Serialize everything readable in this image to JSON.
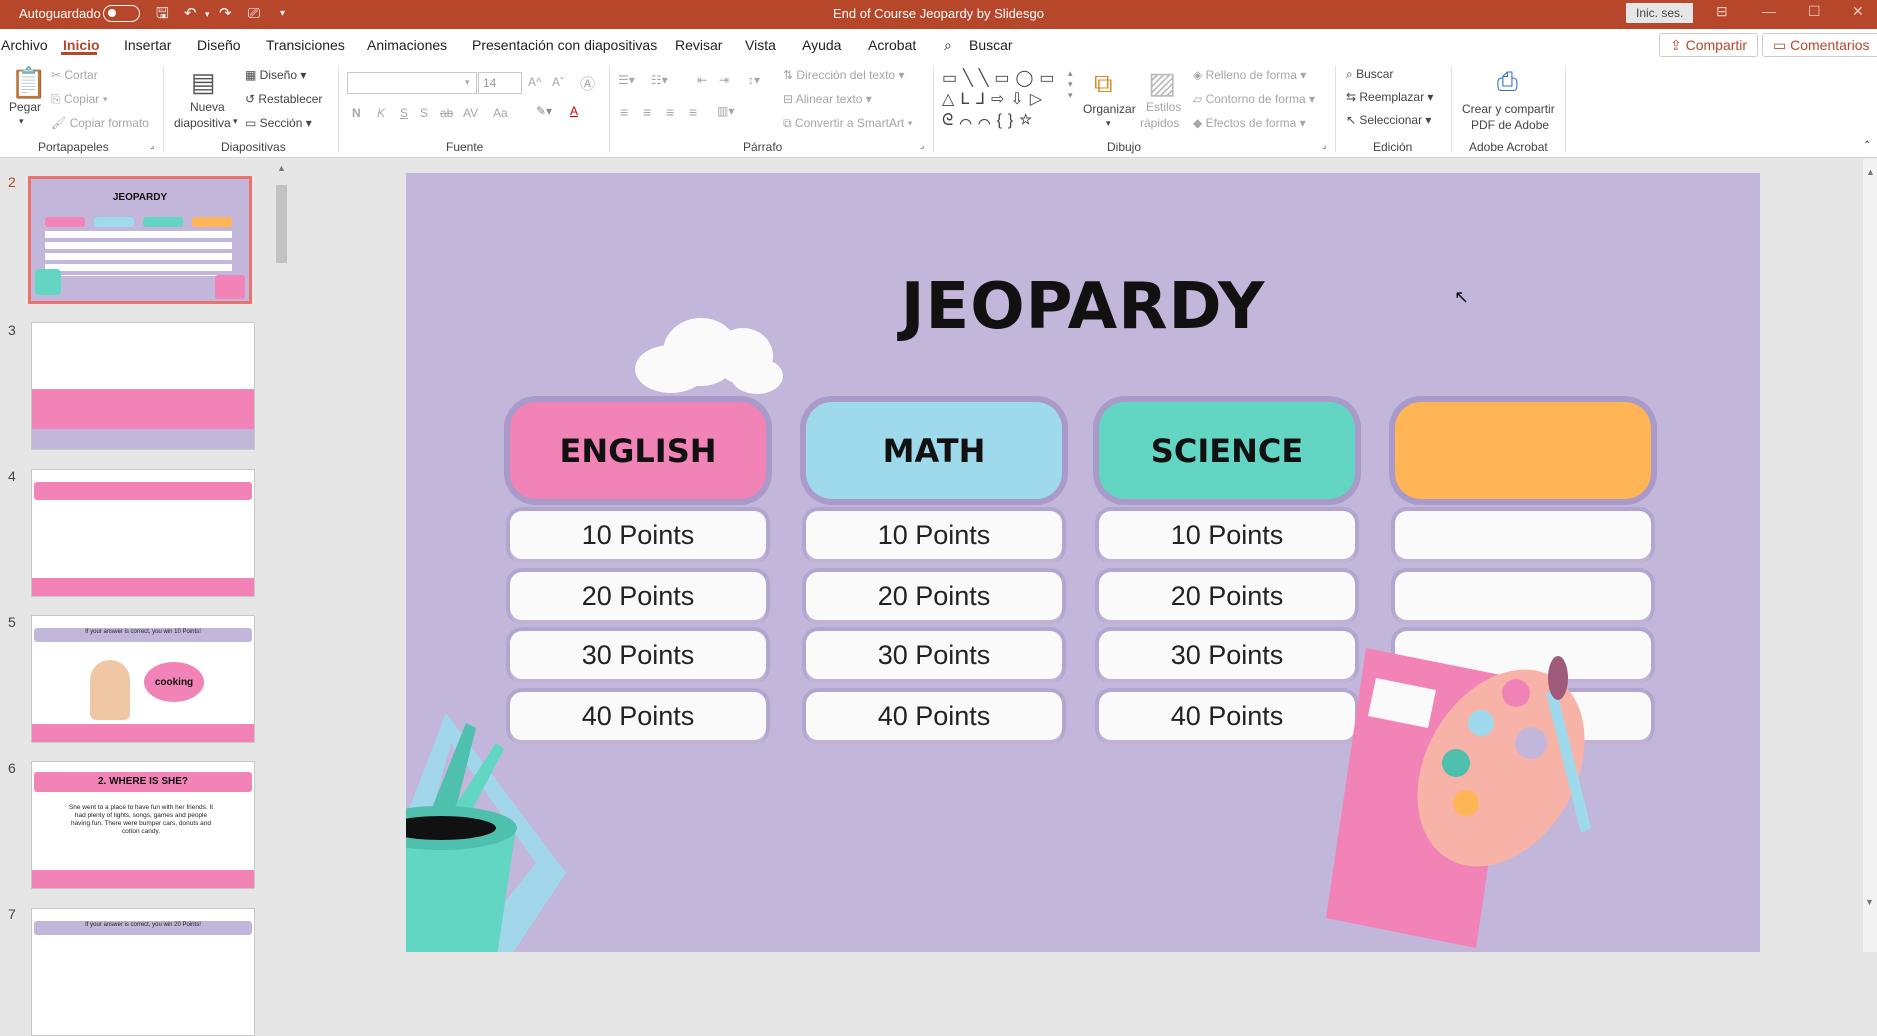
{
  "titlebar": {
    "autosave": "Autoguardado",
    "doc_title": "End of Course Jeopardy by Slidesgo",
    "signin": "Inic. ses."
  },
  "menu": {
    "tabs": [
      "Archivo",
      "Inicio",
      "Insertar",
      "Diseño",
      "Transiciones",
      "Animaciones",
      "Presentación con diapositivas",
      "Revisar",
      "Vista",
      "Ayuda",
      "Acrobat"
    ],
    "active_tab": "Inicio",
    "search": "Buscar",
    "share": "Compartir",
    "comments": "Comentarios"
  },
  "ribbon": {
    "clipboard": {
      "paste": "Pegar",
      "cut": "Cortar",
      "copy": "Copiar",
      "format_painter": "Copiar formato",
      "group": "Portapapeles"
    },
    "slides": {
      "new_slide_1": "Nueva",
      "new_slide_2": "diapositiva",
      "layout": "Diseño",
      "reset": "Restablecer",
      "section": "Sección",
      "group": "Diapositivas"
    },
    "font": {
      "size": "14",
      "group": "Fuente"
    },
    "paragraph": {
      "text_direction": "Dirección del texto",
      "align_text": "Alinear texto",
      "smartart": "Convertir a SmartArt",
      "group": "Párrafo"
    },
    "drawing": {
      "arrange": "Organizar",
      "quick_styles_1": "Estilos",
      "quick_styles_2": "rápidos",
      "shape_fill": "Relleno de forma",
      "shape_outline": "Contorno de forma",
      "shape_effects": "Efectos de forma",
      "group": "Dibujo"
    },
    "editing": {
      "find": "Buscar",
      "replace": "Reemplazar",
      "select": "Seleccionar",
      "group": "Edición"
    },
    "acrobat": {
      "create_1": "Crear y compartir",
      "create_2": "PDF de Adobe",
      "group": "Adobe Acrobat"
    }
  },
  "thumbnails": [
    {
      "number": "2",
      "selected": true
    },
    {
      "number": "3"
    },
    {
      "number": "4"
    },
    {
      "number": "5",
      "caption": "If your answer is correct, you win 10 Points!",
      "bubble": "cooking"
    },
    {
      "number": "6",
      "heading": "2. WHERE IS SHE?",
      "body": "She went to a place to have fun with her friends. It had plenty of lights, songs, games and people having fun. There were bumper cars, donuts and cotton candy."
    },
    {
      "number": "7",
      "caption": "If your answer is correct, you win 20 Points!"
    }
  ],
  "slide": {
    "title": "JEOPARDY",
    "categories": [
      {
        "name": "ENGLISH",
        "color": "#f283b6"
      },
      {
        "name": "MATH",
        "color": "#9fdaec"
      },
      {
        "name": "SCIENCE",
        "color": "#62d6c2"
      },
      {
        "name": "",
        "color": "#ffb455"
      }
    ],
    "rows": [
      [
        "10 Points",
        "10 Points",
        "10 Points",
        ""
      ],
      [
        "20 Points",
        "20 Points",
        "20 Points",
        ""
      ],
      [
        "30 Points",
        "30 Points",
        "30 Points",
        ""
      ],
      [
        "40 Points",
        "40 Points",
        "40 Points",
        ""
      ]
    ]
  },
  "colors": {
    "accent": "#b7472a",
    "slide_bg": "#c2b6db"
  }
}
